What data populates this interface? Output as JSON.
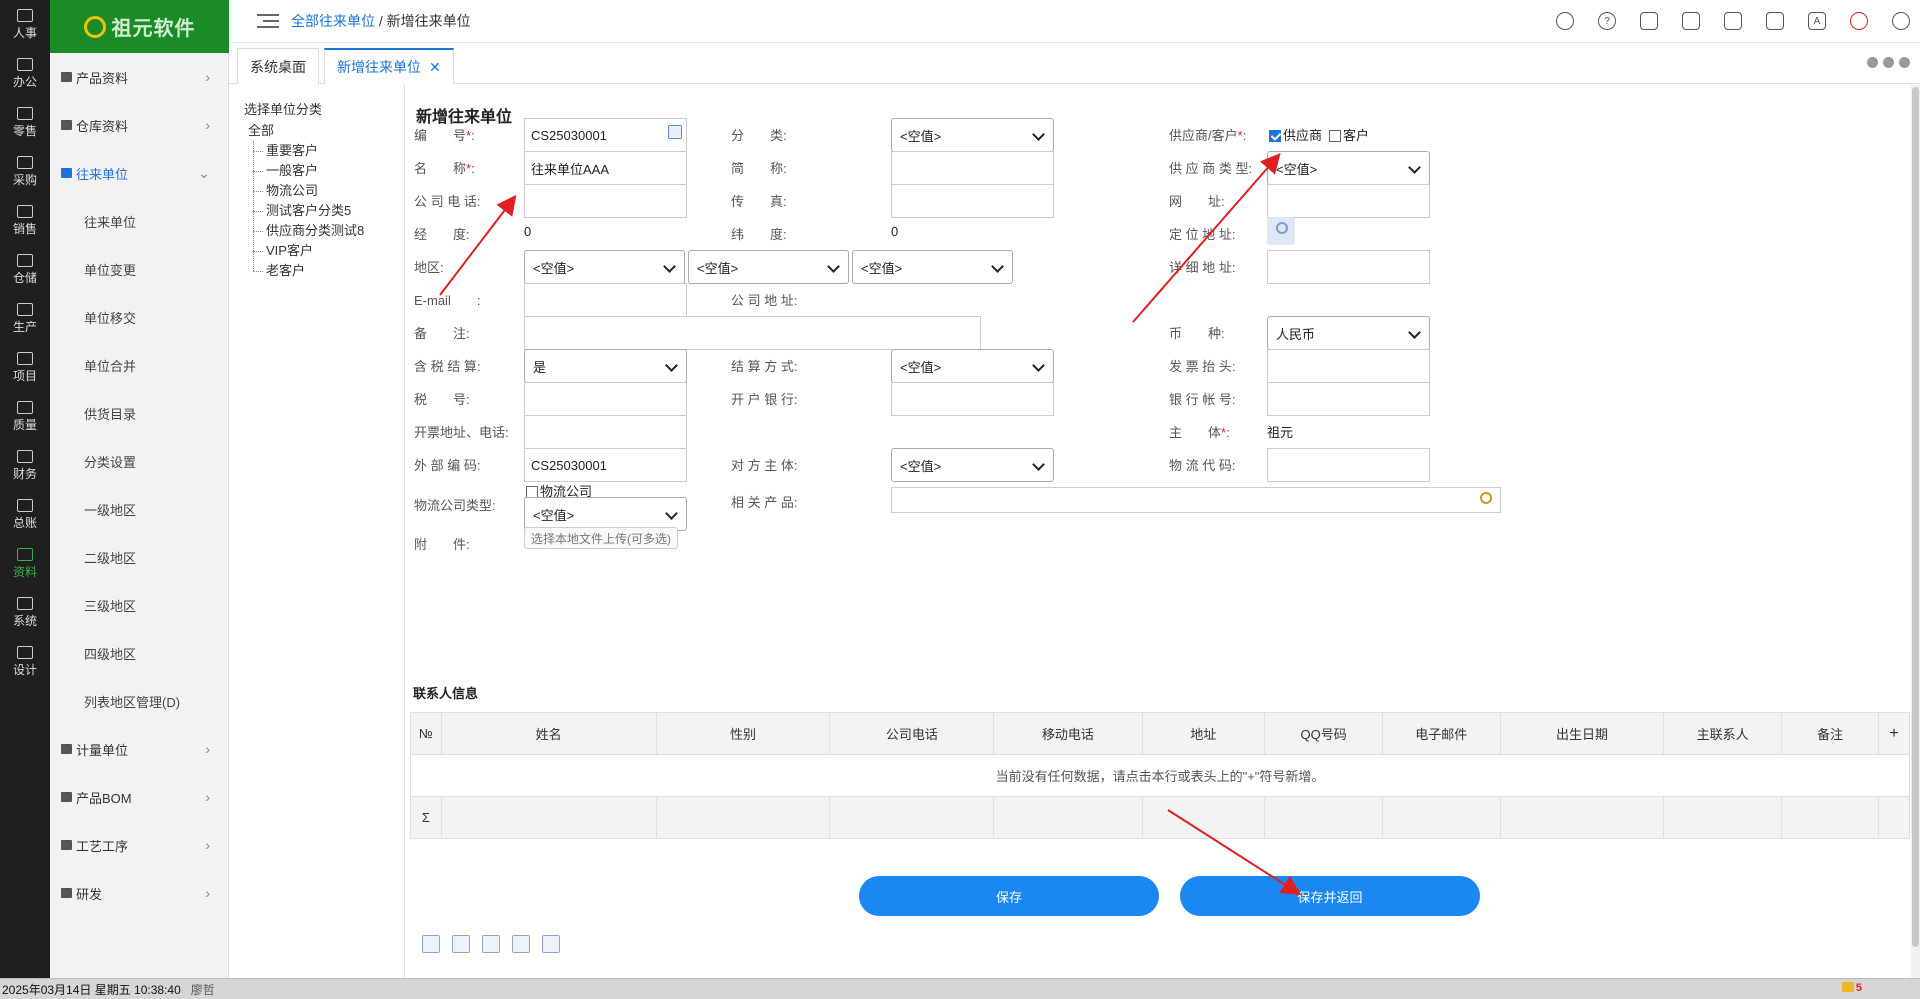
{
  "rail": [
    {
      "label": "人事",
      "icon": "people-icon"
    },
    {
      "label": "办公",
      "icon": "monitor-icon"
    },
    {
      "label": "零售",
      "icon": "store-icon"
    },
    {
      "label": "采购",
      "icon": "truck-icon"
    },
    {
      "label": "销售",
      "icon": "sales-icon"
    },
    {
      "label": "仓储",
      "icon": "warehouse-icon"
    },
    {
      "label": "生产",
      "icon": "factory-icon"
    },
    {
      "label": "项目",
      "icon": "layers-icon"
    },
    {
      "label": "质量",
      "icon": "shield-icon"
    },
    {
      "label": "财务",
      "icon": "finance-icon"
    },
    {
      "label": "总账",
      "icon": "ledger-icon"
    },
    {
      "label": "资料",
      "icon": "document-icon"
    },
    {
      "label": "系统",
      "icon": "gear-icon"
    },
    {
      "label": "设计",
      "icon": "tools-icon"
    }
  ],
  "logo": {
    "text": "祖元软件"
  },
  "menu": {
    "items": [
      {
        "label": "产品资料"
      },
      {
        "label": "仓库资料"
      },
      {
        "label": "往来单位"
      }
    ],
    "sub_items": [
      "往来单位",
      "单位变更",
      "单位移交",
      "单位合并",
      "供货目录",
      "分类设置",
      "一级地区",
      "二级地区",
      "三级地区",
      "四级地区",
      "列表地区管理(D)"
    ],
    "items_after": [
      {
        "label": "计量单位"
      },
      {
        "label": "产品BOM"
      },
      {
        "label": "工艺工序"
      },
      {
        "label": "研发"
      }
    ]
  },
  "breadcrumb": {
    "link": "全部往来单位",
    "separator": " / ",
    "current": "新增往来单位"
  },
  "tabs": [
    {
      "label": "系统桌面"
    },
    {
      "label": "新增往来单位",
      "close": "✕"
    }
  ],
  "tree": {
    "label": "选择单位分类",
    "root": "全部",
    "nodes": [
      "重要客户",
      "一般客户",
      "物流公司",
      "测试客户分类5",
      "供应商分类测试8",
      "VIP客户",
      "老客户"
    ]
  },
  "form": {
    "title": "新增往来单位",
    "labels": {
      "code": "编　　号",
      "name": "名　　称",
      "phone": "公 司 电 话",
      "lng": "经　　度",
      "region": "地区:",
      "email": "E-mail　　",
      "remark": "备　　注",
      "tax_calc": "含 税 结 算",
      "tax_no": "税　　号",
      "invoice_addr": "开票地址、电话",
      "ext_code": "外 部 编 码",
      "logistics_type": "物流公司类型",
      "attach": "附　　件",
      "category": "分　　类",
      "short": "简　　称",
      "fax": "传　　真",
      "lat": "纬　　度",
      "company_addr": "公 司 地 址",
      "settle": "结 算 方 式",
      "bank": "开 户 银 行",
      "counter_entity": "对 方 主 体",
      "related_product": "相 关 产 品",
      "supplier_customer": "供应商/客户",
      "supplier_type": "供 应 商 类 型",
      "website": "网　　址",
      "locate": "定 位 地 址",
      "detail_addr": "详 细 地 址",
      "currency": "币　　种",
      "invoice_title": "发 票 抬 头",
      "bank_account": "银 行 帐 号",
      "entity": "主　　体",
      "logistics_code": "物 流 代 码"
    },
    "values": {
      "code": "CS25030001",
      "name": "往来单位AAA",
      "lng": "0",
      "lat": "0",
      "region1": "<空值>",
      "region2": "<空值>",
      "region3": "<空值>",
      "tax_calc": "是",
      "ext_code": "CS25030001",
      "logistics_type": "<空值>",
      "category": "<空值>",
      "settle": "<空值>",
      "counter_entity": "<空值>",
      "supplier_type": "<空值>",
      "currency": "人民币",
      "entity": "祖元"
    },
    "checkboxes": {
      "supplier": "供应商",
      "supplier_checked": true,
      "customer": "客户",
      "customer_checked": false,
      "logistics": "物流公司",
      "logistics_checked": false
    },
    "upload_label": "选择本地文件上传(可多选)"
  },
  "contacts": {
    "title": "联系人信息",
    "columns": [
      "№",
      "姓名",
      "性别",
      "公司电话",
      "移动电话",
      "地址",
      "QQ号码",
      "电子邮件",
      "出生日期",
      "主联系人",
      "备注"
    ],
    "empty_text": "当前没有任何数据，请点击本行或表头上的\"+\"符号新增。",
    "sum_symbol": "Σ",
    "add_symbol": "+"
  },
  "buttons": {
    "save": "保存",
    "save_return": "保存并返回"
  },
  "statusbar": {
    "datetime": "2025年03月14日 星期五 10:38:40",
    "user": "廖哲",
    "badge": "5"
  },
  "colors": {
    "accent": "#1e73d8",
    "logo_bg": "#1a8b26",
    "button": "#1b87f0",
    "arrow": "#e02020",
    "required": "#e02020"
  }
}
